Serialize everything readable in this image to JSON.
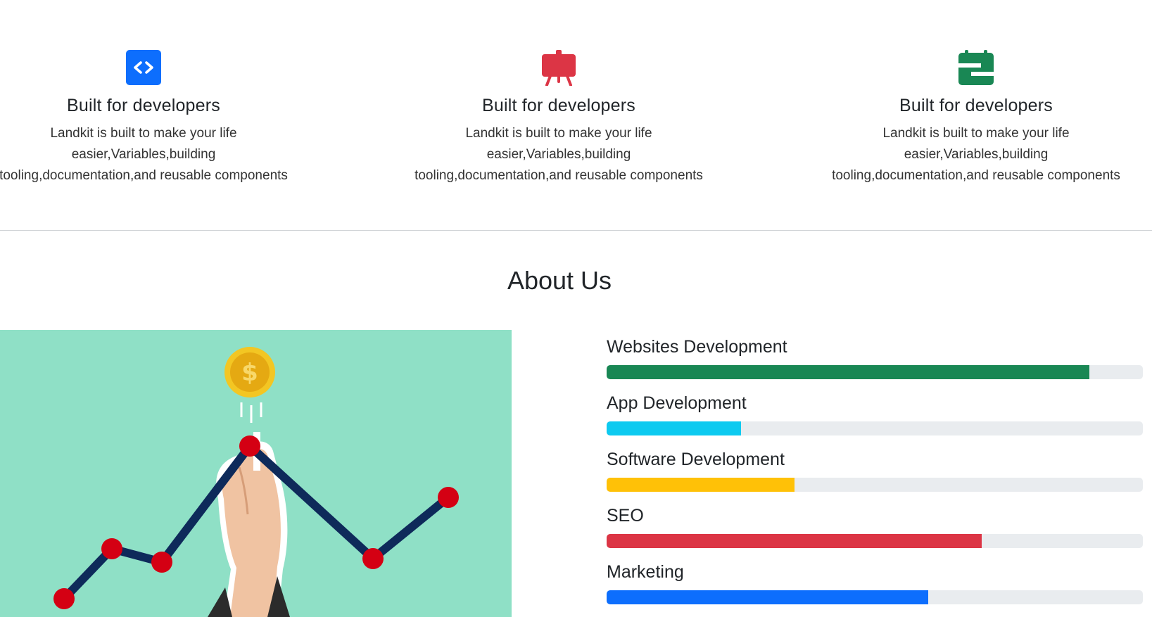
{
  "features": [
    {
      "icon": "code-icon",
      "color": "#0d6efd",
      "title": "Built for developers",
      "line1": "Landkit is built to make your life",
      "line2": "easier,Variables,building",
      "line3": "tooling,documentation,and reusable components"
    },
    {
      "icon": "easel-icon",
      "color": "#dc3545",
      "title": "Built for developers",
      "line1": "Landkit is built to make your life",
      "line2": "easier,Variables,building",
      "line3": "tooling,documentation,and reusable components"
    },
    {
      "icon": "wallet-icon",
      "color": "#198754",
      "title": "Built for developers",
      "line1": "Landkit is built to make your life",
      "line2": "easier,Variables,building",
      "line3": "tooling,documentation,and reusable components"
    }
  ],
  "about": {
    "title": "About Us",
    "image_icon": "growth-chart-illustration"
  },
  "skills": [
    {
      "label": "Websites Development",
      "percent": 90,
      "color": "#198754"
    },
    {
      "label": "App Development",
      "percent": 25,
      "color": "#0dcaf0"
    },
    {
      "label": "Software Development",
      "percent": 35,
      "color": "#ffc107"
    },
    {
      "label": "SEO",
      "percent": 70,
      "color": "#dc3545"
    },
    {
      "label": "Marketing",
      "percent": 60,
      "color": "#0d6efd"
    }
  ]
}
